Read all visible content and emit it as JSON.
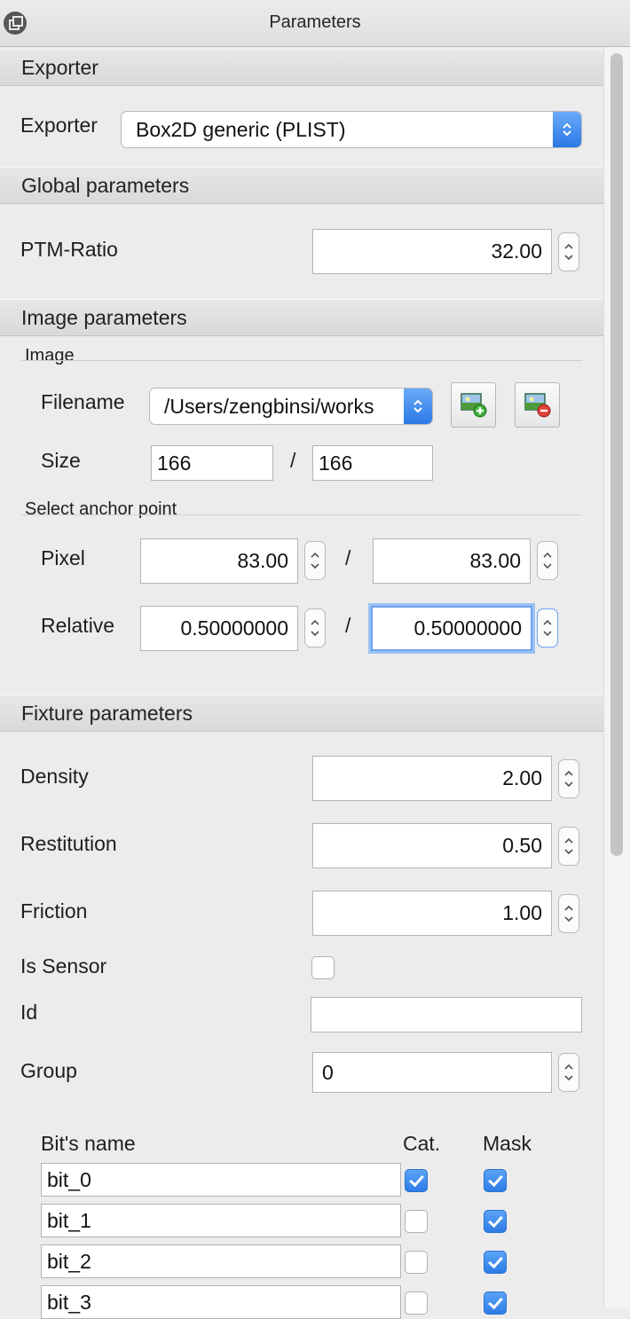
{
  "window": {
    "title": "Parameters"
  },
  "exporter_section": {
    "header": "Exporter",
    "label": "Exporter",
    "value": "Box2D generic (PLIST)"
  },
  "global_section": {
    "header": "Global parameters",
    "ptm_label": "PTM-Ratio",
    "ptm_value": "32.00"
  },
  "image_section": {
    "header": "Image parameters",
    "group_image": "Image",
    "filename_label": "Filename",
    "filename_value": "/Users/zengbinsi/works",
    "size_label": "Size",
    "size_width": "166",
    "size_height": "166",
    "separator": "/",
    "group_anchor": "Select anchor point",
    "pixel_label": "Pixel",
    "pixel_x": "83.00",
    "pixel_y": "83.00",
    "relative_label": "Relative",
    "relative_x": "0.50000000",
    "relative_y": "0.50000000"
  },
  "fixture_section": {
    "header": "Fixture parameters",
    "density_label": "Density",
    "density_value": "2.00",
    "restitution_label": "Restitution",
    "restitution_value": "0.50",
    "friction_label": "Friction",
    "friction_value": "1.00",
    "sensor_label": "Is Sensor",
    "sensor_checked": false,
    "id_label": "Id",
    "id_value": "",
    "group_label": "Group",
    "group_value": "0"
  },
  "bits": {
    "name_header": "Bit's name",
    "cat_header": "Cat.",
    "mask_header": "Mask",
    "rows": [
      {
        "name": "bit_0",
        "cat": true,
        "mask": true
      },
      {
        "name": "bit_1",
        "cat": false,
        "mask": true
      },
      {
        "name": "bit_2",
        "cat": false,
        "mask": true
      },
      {
        "name": "bit_3",
        "cat": false,
        "mask": true
      }
    ]
  },
  "colors": {
    "accent": "#2d7ce6",
    "panel_bg": "#ececec",
    "focus_ring": "#9cc2f5"
  },
  "icons": {
    "window": "window-restore-icon",
    "add_image": "image-add-icon",
    "remove_image": "image-remove-icon"
  }
}
